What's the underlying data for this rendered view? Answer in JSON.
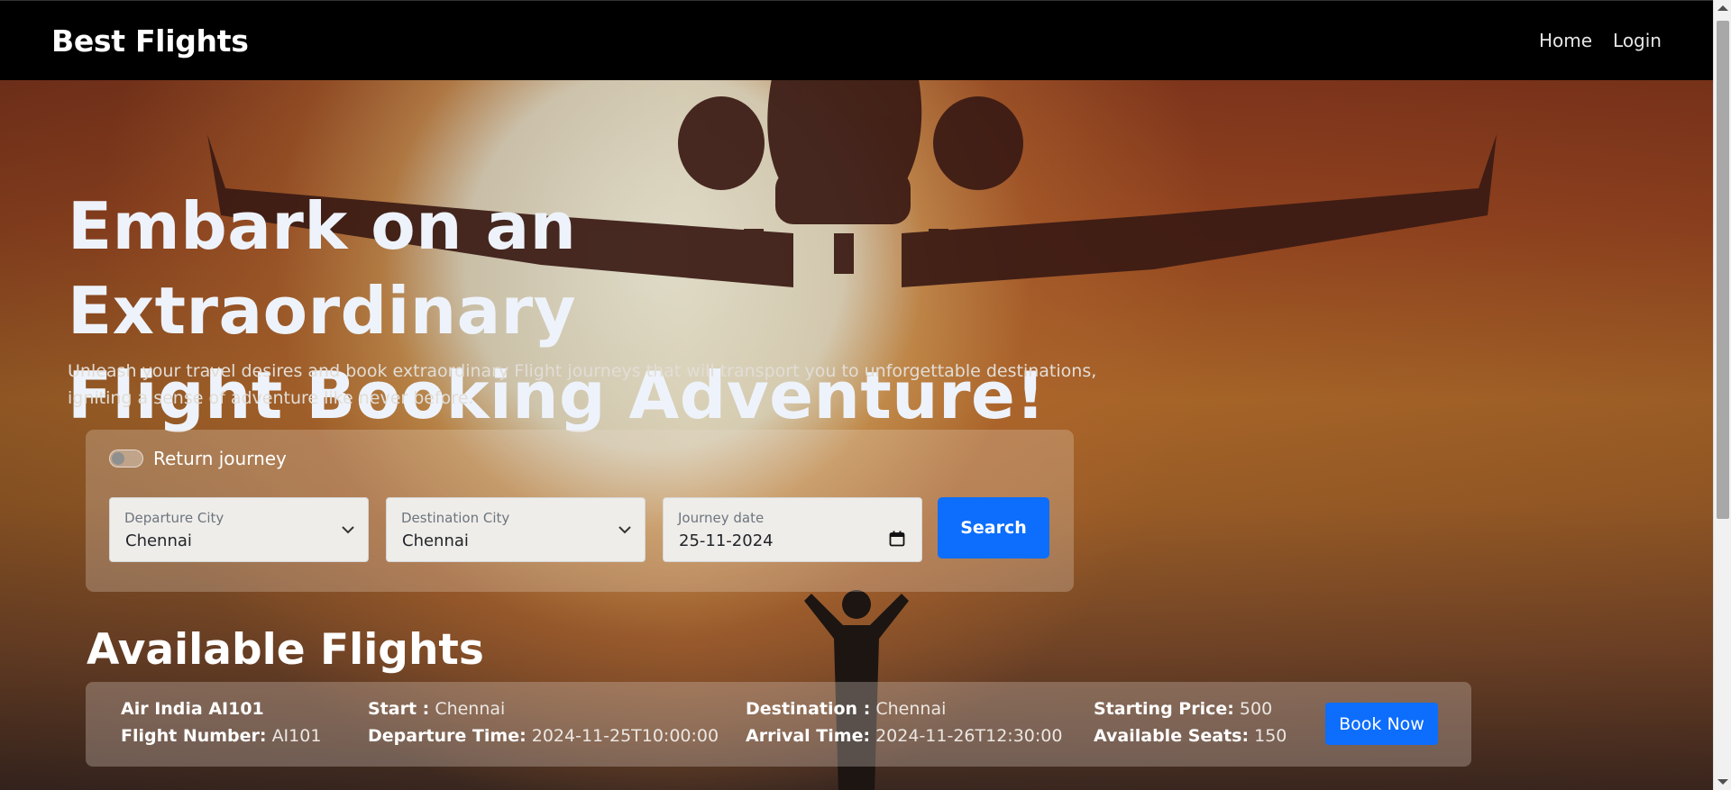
{
  "navbar": {
    "brand": "Best Flights",
    "links": [
      "Home",
      "Login"
    ]
  },
  "hero": {
    "headline_line1": "Embark on an Extraordinary",
    "headline_line2": "Flight Booking Adventure!",
    "subtitle": "Unleash your travel desires and book extraordinary Flight journeys that will transport you to unforgettable destinations, igniting a sense of adventure like never before."
  },
  "search": {
    "return_journey_label": "Return journey",
    "return_journey_on": false,
    "departure_label": "Departure City",
    "departure_value": "Chennai",
    "destination_label": "Destination City",
    "destination_value": "Chennai",
    "date_label": "Journey date",
    "date_value": "25-11-2024",
    "search_button": "Search"
  },
  "flights": {
    "title": "Available Flights",
    "items": [
      {
        "name": "Air India AI101",
        "flight_number_label": "Flight Number:",
        "flight_number": "AI101",
        "start_label": "Start :",
        "start": "Chennai",
        "departure_time_label": "Departure Time:",
        "departure_time": "2024-11-25T10:00:00",
        "destination_label": "Destination :",
        "destination": "Chennai",
        "arrival_time_label": "Arrival Time:",
        "arrival_time": "2024-11-26T12:30:00",
        "price_label": "Starting Price:",
        "price": "500",
        "seats_label": "Available Seats:",
        "seats": "150",
        "book_button": "Book Now"
      }
    ]
  },
  "colors": {
    "primary": "#0d6efd",
    "navbar": "#000000"
  }
}
